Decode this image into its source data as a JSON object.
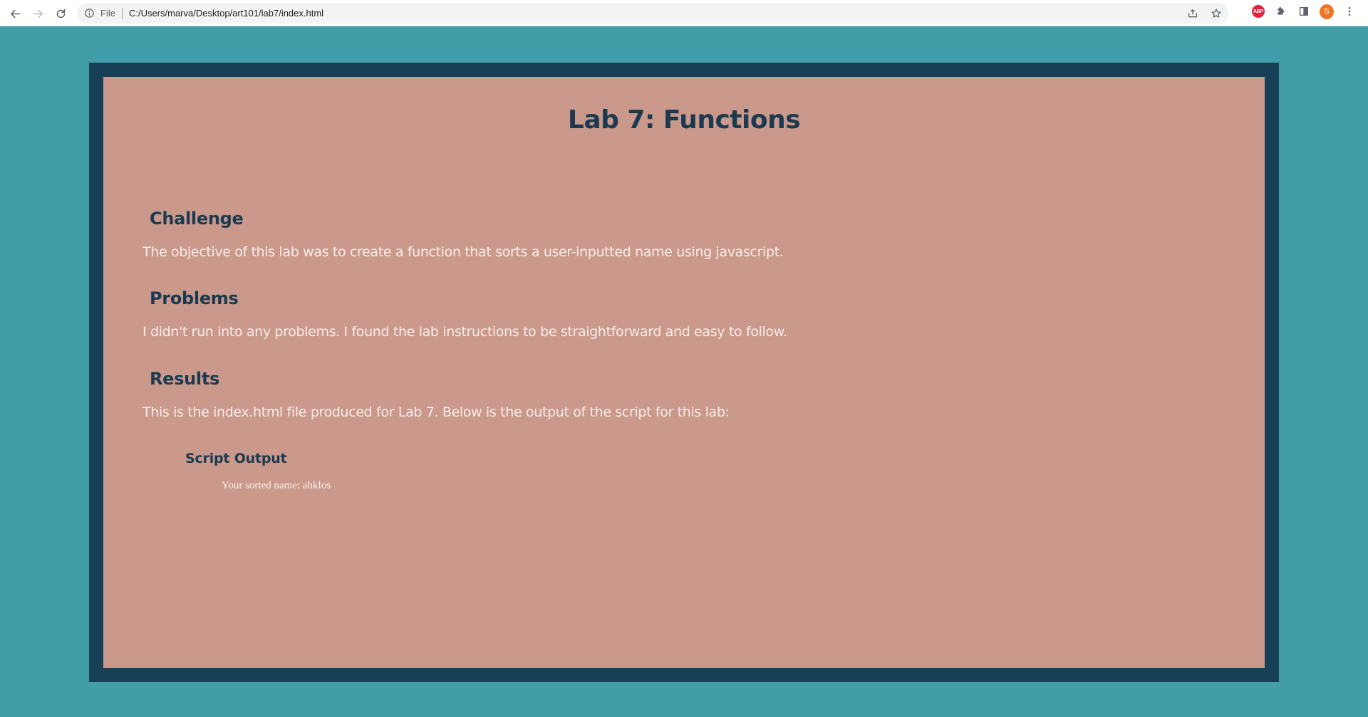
{
  "browser": {
    "scheme_label": "File",
    "url": "C:/Users/marva/Desktop/art101/lab7/index.html",
    "extension_abp_label": "ABP",
    "profile_initial": "S",
    "icons": [
      "back-arrow-icon",
      "forward-arrow-icon",
      "reload-icon",
      "info-icon",
      "share-icon",
      "star-icon",
      "abp-icon",
      "puzzle-icon",
      "side-panel-icon",
      "profile-avatar",
      "more-vertical-icon"
    ]
  },
  "colors": {
    "page_background": "#419ea8",
    "frame": "#173f55",
    "card": "#ca998b",
    "heading": "#1b3a50",
    "body_text": "#f7ece8"
  },
  "page": {
    "title": "Lab 7: Functions",
    "sections": [
      {
        "heading": "Challenge",
        "text": "The objective of this lab was to create a function that sorts a user-inputted name using javascript."
      },
      {
        "heading": "Problems",
        "text": "I didn't run into any problems. I found the lab instructions to be straightforward and easy to follow."
      },
      {
        "heading": "Results",
        "text": "This is the index.html file produced for Lab 7. Below is the output of the script for this lab:"
      }
    ],
    "script_output_heading": "Script Output",
    "script_output_text": "Your sorted name: ahklos"
  }
}
